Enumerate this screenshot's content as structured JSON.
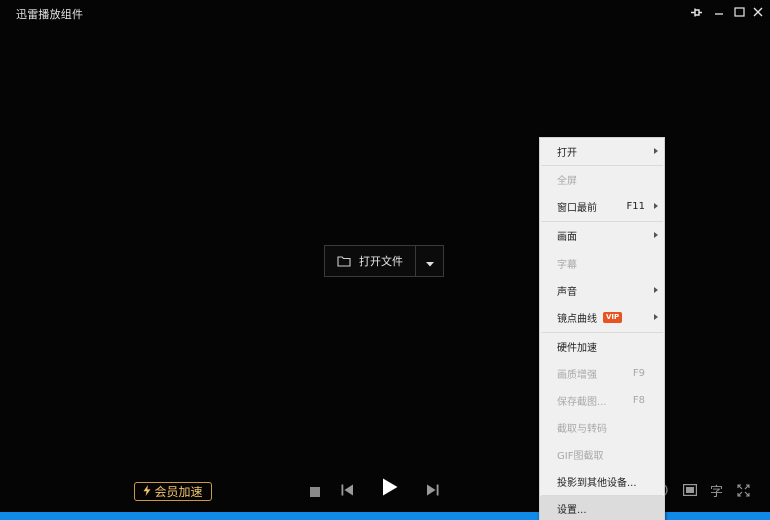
{
  "window": {
    "title": "迅雷播放组件"
  },
  "center": {
    "open_label": "打开文件"
  },
  "bottom": {
    "vip_label": "会员加速"
  },
  "right_controls": {
    "subtitle_glyph": "字"
  },
  "menu": {
    "items": [
      {
        "label": "打开",
        "shortcut": "",
        "disabled": false,
        "submenu": true
      },
      {
        "label": "全屏",
        "shortcut": "",
        "disabled": true,
        "submenu": false
      },
      {
        "label": "窗口最前",
        "shortcut": "F11",
        "disabled": false,
        "submenu": true
      },
      {
        "label": "画面",
        "shortcut": "",
        "disabled": false,
        "submenu": true
      },
      {
        "label": "字幕",
        "shortcut": "",
        "disabled": true,
        "submenu": false
      },
      {
        "label": "声音",
        "shortcut": "",
        "disabled": false,
        "submenu": true
      },
      {
        "label": "镜点曲线",
        "shortcut": "",
        "disabled": false,
        "submenu": true,
        "badge": "VIP"
      },
      {
        "label": "硬件加速",
        "shortcut": "",
        "disabled": false,
        "submenu": false
      },
      {
        "label": "画质增强",
        "shortcut": "F9",
        "disabled": true,
        "submenu": false
      },
      {
        "label": "保存截图...",
        "shortcut": "F8",
        "disabled": true,
        "submenu": false
      },
      {
        "label": "截取与转码",
        "shortcut": "",
        "disabled": true,
        "submenu": false
      },
      {
        "label": "GIF图截取",
        "shortcut": "",
        "disabled": true,
        "submenu": false
      },
      {
        "label": "投影到其他设备...",
        "shortcut": "",
        "disabled": false,
        "submenu": false
      },
      {
        "label": "设置...",
        "shortcut": "",
        "disabled": false,
        "submenu": false
      }
    ]
  },
  "colors": {
    "accent": "#1189e8",
    "vip_gold": "#f0c36a",
    "vip_badge": "#e8531f"
  }
}
